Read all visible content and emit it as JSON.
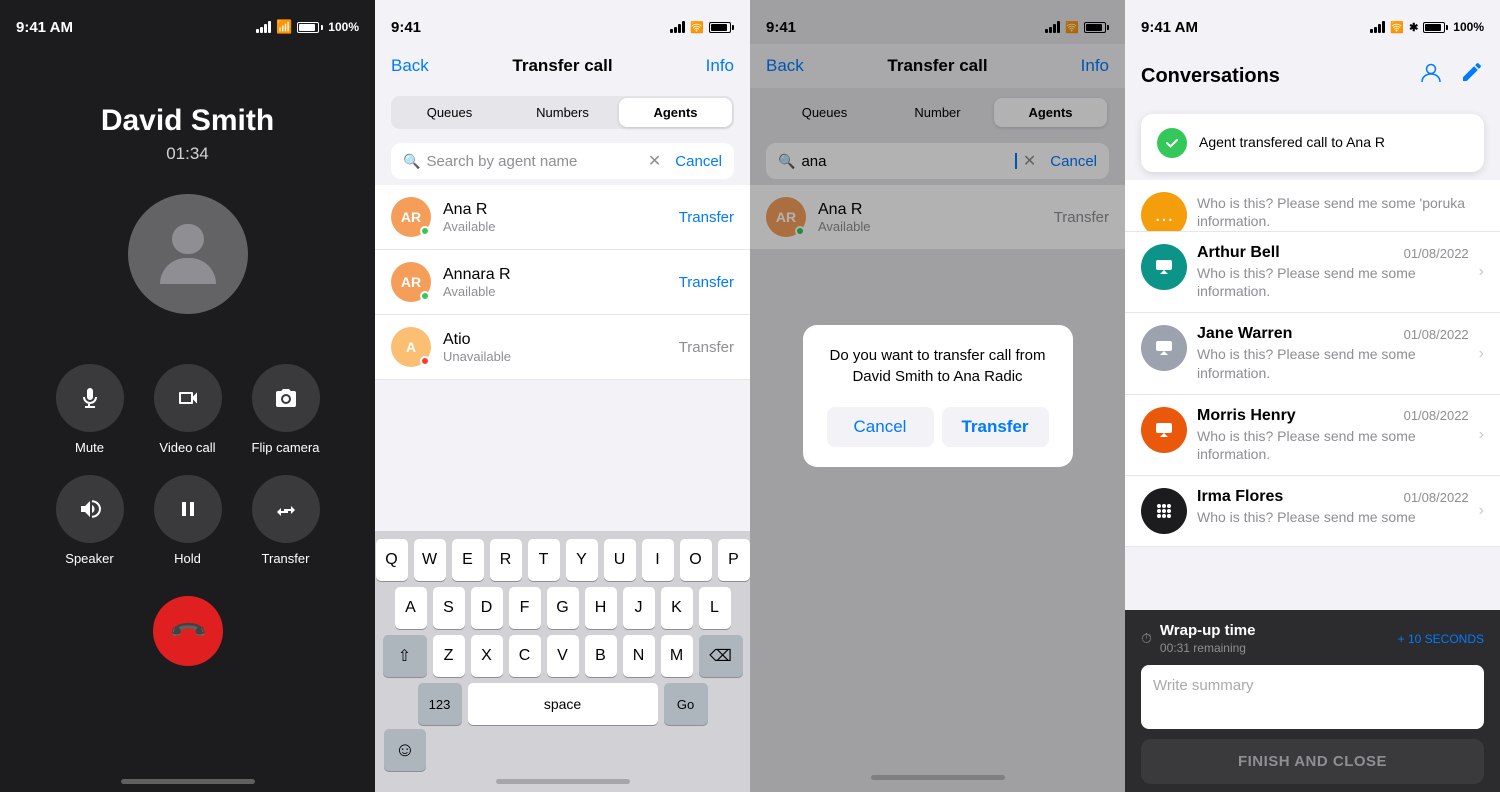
{
  "panel1": {
    "statusBar": {
      "time": "9:41 AM",
      "battery": "100%"
    },
    "callerName": "David Smith",
    "timer": "01:34",
    "buttons": {
      "row1": [
        "Mute",
        "Video call",
        "Flip camera"
      ],
      "row2": [
        "Speaker",
        "Hold",
        "Transfer"
      ]
    }
  },
  "panel2": {
    "statusBar": {
      "time": "9:41"
    },
    "nav": {
      "back": "Back",
      "title": "Transfer call",
      "info": "Info"
    },
    "tabs": [
      "Queues",
      "Numbers",
      "Agents"
    ],
    "activeTab": "Agents",
    "search": {
      "placeholder": "Search by agent name"
    },
    "agents": [
      {
        "initials": "AR",
        "name": "Ana R",
        "status": "Available",
        "available": true
      },
      {
        "initials": "AR",
        "name": "Annara R",
        "status": "Available",
        "available": true
      },
      {
        "initials": "A",
        "name": "Atio",
        "status": "Unavailable",
        "available": false
      }
    ],
    "keyboard": {
      "rows": [
        [
          "Q",
          "W",
          "E",
          "R",
          "T",
          "Y",
          "U",
          "I",
          "O",
          "P"
        ],
        [
          "A",
          "S",
          "D",
          "F",
          "G",
          "H",
          "J",
          "K",
          "L"
        ],
        [
          "⇧",
          "Z",
          "X",
          "C",
          "V",
          "B",
          "N",
          "M",
          "⌫"
        ],
        [
          "123",
          "space",
          "Go"
        ]
      ]
    }
  },
  "panel3": {
    "statusBar": {
      "time": "9:41"
    },
    "nav": {
      "back": "Back",
      "title": "Transfer call",
      "info": "Info"
    },
    "tabs": [
      "Queues",
      "Number",
      "Agents"
    ],
    "activeTab": "Agents",
    "searchValue": "ana",
    "agents": [
      {
        "initials": "AR",
        "name": "Ana R",
        "status": "Available",
        "available": true
      }
    ],
    "modal": {
      "message": "Do you want to transfer call from David Smith to Ana Radic",
      "cancelLabel": "Cancel",
      "transferLabel": "Transfer"
    }
  },
  "panel4": {
    "statusBar": {
      "time": "9:41 AM",
      "battery": "100%"
    },
    "title": "Conversations",
    "toast": {
      "message": "Agent transfered call to Ana R"
    },
    "conversations": [
      {
        "initials": "⋯",
        "bg": "yellow",
        "name": "(hidden)",
        "date": "",
        "preview": "Who is this? Please send me some 'poruka information.",
        "chevron": true
      },
      {
        "initials": "⊕",
        "bg": "teal",
        "name": "Arthur Bell",
        "date": "01/08/2022",
        "preview": "Who is this? Please send me some information.",
        "chevron": true
      },
      {
        "initials": "⊕",
        "bg": "gray",
        "name": "Jane Warren",
        "date": "01/08/2022",
        "preview": "Who is this? Please send me some information.",
        "chevron": true
      },
      {
        "initials": "⊕",
        "bg": "orange",
        "name": "Morris Henry",
        "date": "01/08/2022",
        "preview": "Who is this? Please send me some information.",
        "chevron": true
      },
      {
        "initials": "⊞",
        "bg": "grid",
        "name": "Irma Flores",
        "date": "01/08/2022",
        "preview": "Who is this? Please send me some",
        "chevron": true
      }
    ],
    "wrapUp": {
      "title": "Wrap-up time",
      "timer": "00:31 remaining",
      "addTime": "+ 10 SECONDS",
      "placeholder": "Write summary",
      "finishBtn": "FINISH AND CLOSE"
    }
  }
}
